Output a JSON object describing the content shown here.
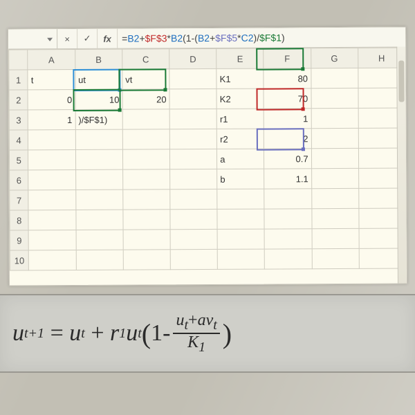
{
  "formula_bar": {
    "name_box": "",
    "cancel": "×",
    "confirm": "✓",
    "fx": "fx",
    "tokens": {
      "eq": "=",
      "b2": "B2",
      "plus": "+",
      "f3": "$F$3",
      "star": "*",
      "b2b": "B2",
      "open1": "(",
      "one": "1",
      "minus": "-",
      "open2": "(",
      "b2c": "B2",
      "plus2": "+",
      "f5": "$F$5",
      "star2": "*",
      "c2": "C2",
      "close2": ")",
      "slash": "/",
      "f1": "$F$1",
      "close1": ")"
    }
  },
  "columns": [
    "A",
    "B",
    "C",
    "D",
    "E",
    "F",
    "G",
    "H"
  ],
  "rows": [
    "1",
    "2",
    "3",
    "4",
    "5",
    "6",
    "7",
    "8",
    "9",
    "10"
  ],
  "cells": {
    "A1": "t",
    "B1": "ut",
    "C1": "vt",
    "A2": "0",
    "B2": "10",
    "C2": "20",
    "A3": "1",
    "B3": ")/$F$1)",
    "E1": "K1",
    "F1": "80",
    "E2": "K2",
    "F2": "70",
    "E3": "r1",
    "F3": "1",
    "E4": "r2",
    "F4": "2",
    "E5": "a",
    "F5": "0.7",
    "E6": "b",
    "F6": "1.1"
  },
  "equation": {
    "lhs_u": "u",
    "lhs_sub": "t+1",
    "eq": "=",
    "u2": "u",
    "sub_t": "t",
    "plus": "+",
    "r": "r",
    "r_sub": "1",
    "u3": "u",
    "sub_t2": "t",
    "lp": "(",
    "one": "1",
    "minus": "-",
    "num": "u_t + a v_t",
    "num_u": "u",
    "num_ut": "t",
    "num_plus": "+",
    "num_a": "a",
    "num_v": "v",
    "num_vt": "t",
    "den_K": "K",
    "den_K1": "1",
    "rp": ")"
  }
}
